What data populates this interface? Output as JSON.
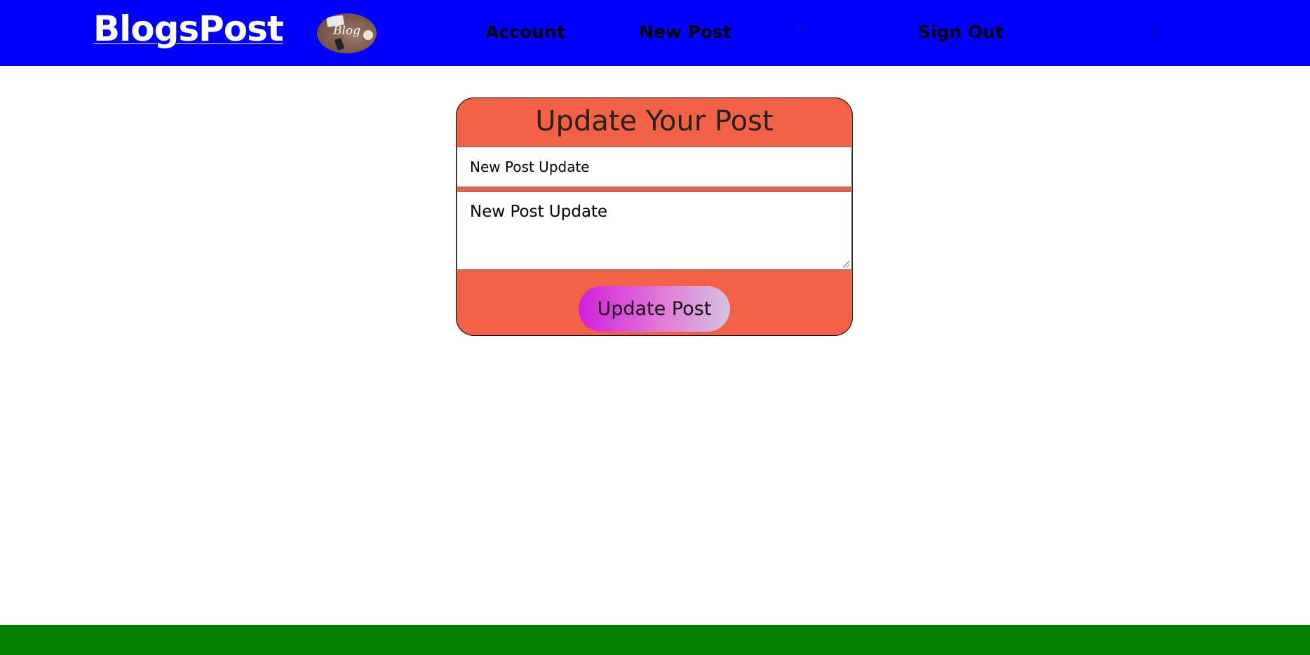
{
  "navbar": {
    "brand": "BlogsPost",
    "logo_text": "Blog",
    "links": {
      "account": "Account",
      "new_post": "New Post",
      "sign_out": "Sign Out"
    }
  },
  "form": {
    "title": "Update Your Post",
    "title_value": "New Post Update",
    "body_value": "New Post Update",
    "submit_label": "Update Post"
  },
  "colors": {
    "navbar": "#0000ff",
    "card": "#f26144",
    "footer": "#008000",
    "button_gradient_start": "#d11fdb",
    "button_gradient_end": "#d6c3df"
  }
}
